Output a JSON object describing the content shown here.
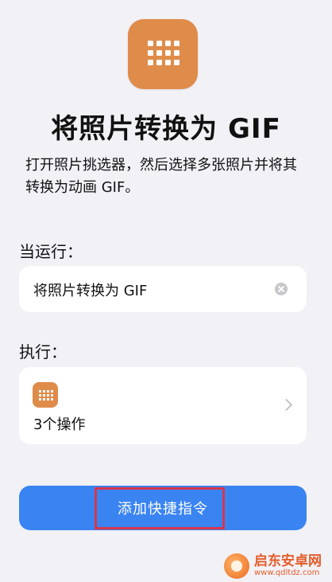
{
  "header": {
    "icon": "grid-apps-icon",
    "icon_color": "#df8b4a",
    "title": "将照片转换为 GIF",
    "description": "打开照片挑选器，然后选择多张照片并将其转换为动画 GIF。"
  },
  "when_run": {
    "label": "当运行：",
    "input_value": "将照片转换为 GIF",
    "clear_icon": "clear-circle-icon"
  },
  "execute": {
    "label": "执行：",
    "action_icon": "grid-apps-icon",
    "actions_count": "3个操作",
    "chevron_icon": "chevron-right-icon"
  },
  "primary_button": {
    "label": "添加快捷指令",
    "color": "#3a84f2"
  },
  "highlight_color": "#d9364a",
  "watermark": {
    "title": "启东安卓网",
    "url": "www.qdltdz.com"
  }
}
